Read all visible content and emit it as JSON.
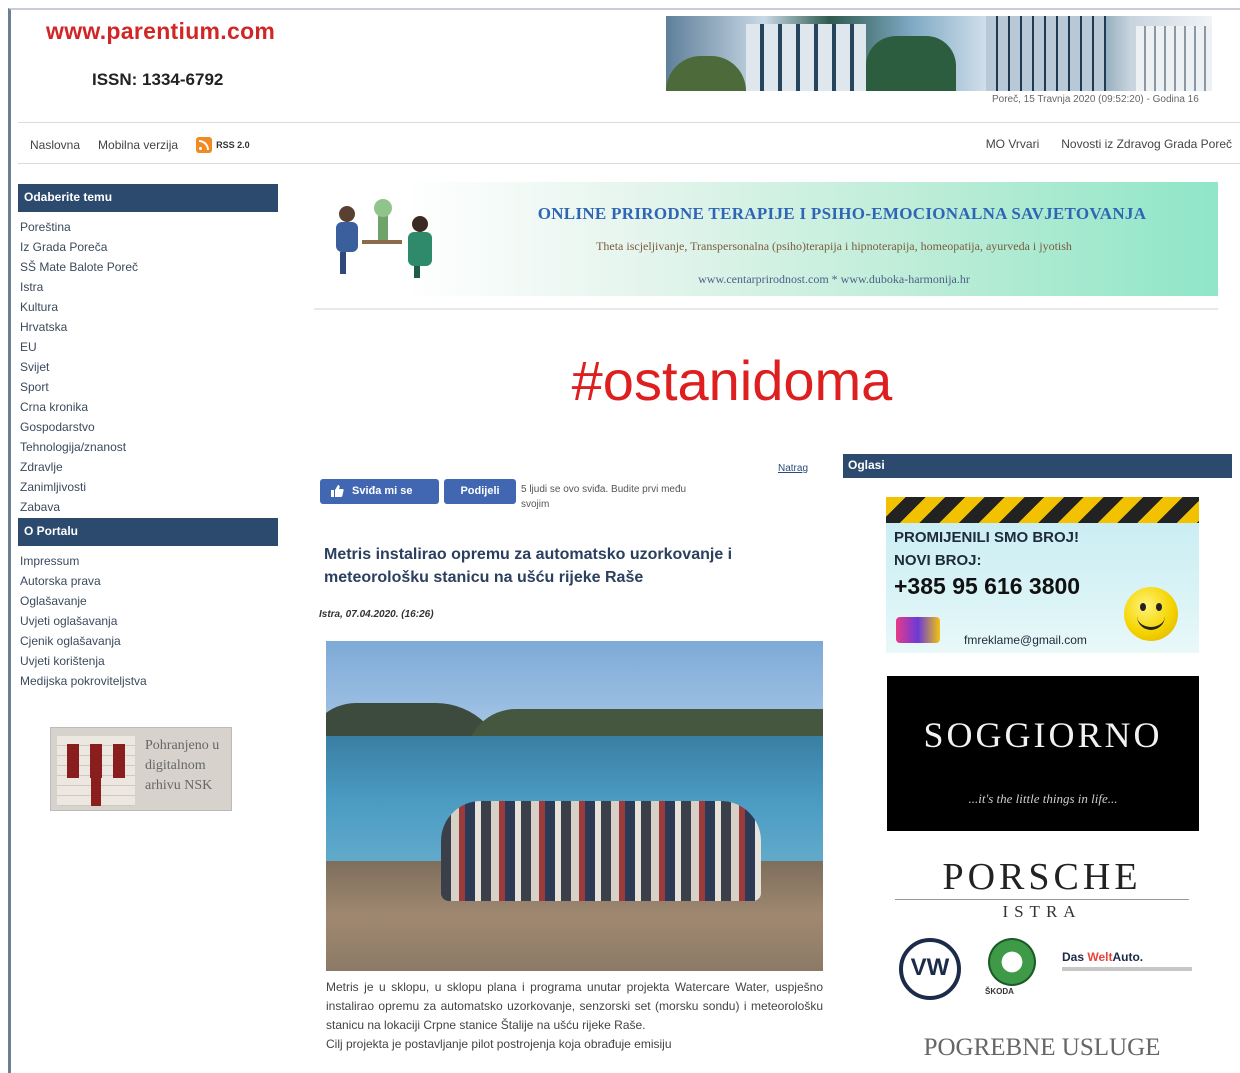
{
  "header": {
    "site_name": "www.parentium.com",
    "issn": "ISSN: 1334-6792",
    "date": "Poreč, 15 Travnja 2020 (09:52:20) - Godina 16"
  },
  "nav": {
    "left": [
      "Naslovna",
      "Mobilna verzija"
    ],
    "rss_label": "RSS 2.0",
    "right": [
      "MO Vrvari",
      "Novosti iz Zdravog Grada Poreč"
    ]
  },
  "sidebar": {
    "themes_title": "Odaberite temu",
    "themes": [
      "Poreština",
      "Iz Grada Poreča",
      "SŠ Mate Balote Poreč",
      "Istra",
      "Kultura",
      "Hrvatska",
      "EU",
      "Svijet",
      "Sport",
      "Crna kronika",
      "Gospodarstvo",
      "Tehnologija/znanost",
      "Zdravlje",
      "Zanimljivosti",
      "Zabava"
    ],
    "portal_title": "O Portalu",
    "portal": [
      "Impressum",
      "Autorska prava",
      "Oglašavanje",
      "Uvjeti oglašavanja",
      "Cjenik oglašavanja",
      "Uvjeti korištenja",
      "Medijska pokroviteljstva"
    ],
    "archive_text": "Pohranjeno u digitalnom arhivu NSK"
  },
  "top_ad": {
    "title": "ONLINE PRIRODNE TERAPIJE I PSIHO-EMOCIONALNA SAVJETOVANJA",
    "subtitle": "Theta iscjeljivanje, Transpersonalna (psiho)terapija i hipnoterapija, homeopatija, ayurveda i jyotish",
    "links": "www.centarprirodnost.com  *  www.duboka-harmonija.hr"
  },
  "hashtag": "#ostanidoma",
  "facebook": {
    "like_label": "Sviđa mi se",
    "share_label": "Podijeli",
    "social_text": "5 ljudi se ovo sviđa. Budite prvi među svojim"
  },
  "article": {
    "back_label": "Natrag",
    "title": "Metris instalirao opremu za automatsko uzorkovanje i meteorološku stanicu na ušću rijeke Raše",
    "meta": "Istra, 07.04.2020. (16:26)",
    "body_1": "Metris je u sklopu, u sklopu plana i programa unutar projekta Watercare Water, uspješno instalirao opremu za automatsko uzorkovanje, senzorski set (morsku sondu) i meteorološku stanicu na lokaciji Crpne stanice Štalije na ušću rijeke Raše.",
    "body_2": "Cilj projekta je postavljanje pilot postrojenja koja obrađuje emisiju"
  },
  "ads": {
    "title": "Oglasi",
    "radio": {
      "line1": "PROMIJENILI SMO BROJ!",
      "line2": "NOVI BROJ:",
      "phone": "+385 95 616 3800",
      "email": "fmreklame@gmail.com"
    },
    "soggiorno": {
      "name": "SOGGIORNO",
      "tagline": "...it's the little things in life..."
    },
    "porsche": {
      "brand": "PORSCHE",
      "sub": "ISTRA",
      "skoda": "ŠKODA",
      "dwa_1": "Das ",
      "dwa_2": "Welt",
      "dwa_3": "Auto."
    },
    "pogrebne": "POGREBNE USLUGE"
  }
}
